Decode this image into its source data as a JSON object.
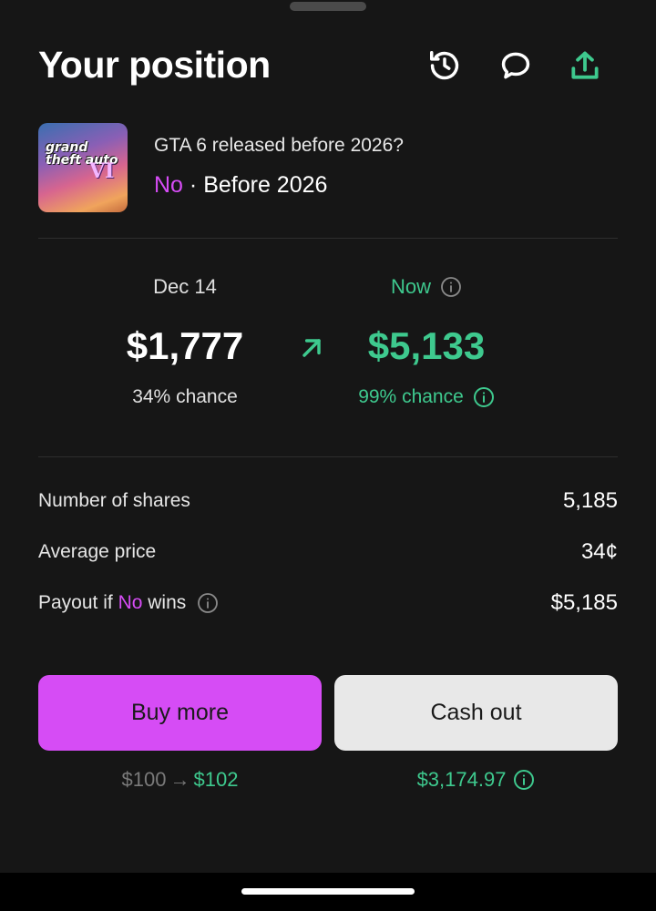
{
  "header": {
    "title": "Your position",
    "icons": [
      "history-icon",
      "comment-icon",
      "share-icon"
    ]
  },
  "market": {
    "question": "GTA 6 released before 2026?",
    "outcome": "No",
    "separator": " · ",
    "outcome_detail": "Before 2026",
    "thumbnail_text": "grand theft auto",
    "thumbnail_numeral": "VI"
  },
  "comparison": {
    "then": {
      "label": "Dec 14",
      "value": "$1,777",
      "chance": "34% chance"
    },
    "now": {
      "label": "Now",
      "value": "$5,133",
      "chance": "99% chance"
    }
  },
  "stats": {
    "shares_label": "Number of shares",
    "shares_value": "5,185",
    "avg_price_label": "Average price",
    "avg_price_value": "34¢",
    "payout_label_prefix": "Payout if ",
    "payout_label_outcome": "No",
    "payout_label_suffix": " wins",
    "payout_value": "$5,185"
  },
  "actions": {
    "buy_label": "Buy more",
    "cash_label": "Cash out",
    "buy_sub_old": "$100",
    "buy_sub_arrow": "→",
    "buy_sub_new": "$102",
    "cash_sub": "$3,174.97"
  },
  "colors": {
    "background": "#161616",
    "accent_green": "#3ec98e",
    "accent_purple": "#d64cf5",
    "button_light": "#e8e8e8"
  }
}
